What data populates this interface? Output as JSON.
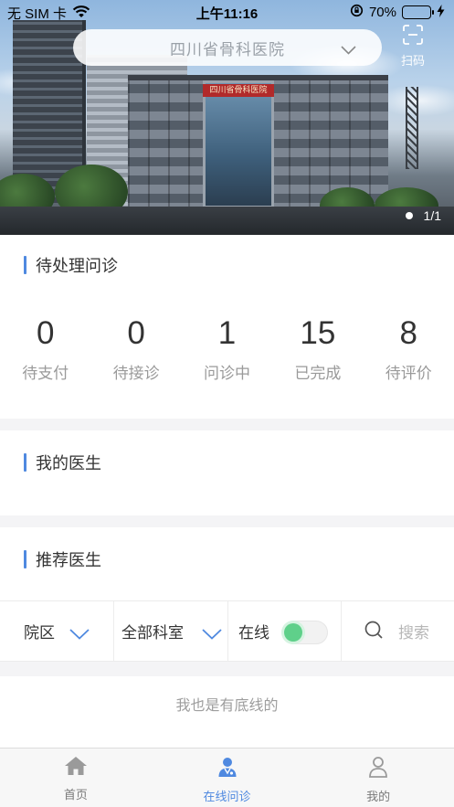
{
  "status_bar": {
    "carrier": "无 SIM 卡",
    "time": "上午11:16",
    "battery": "70%",
    "battery_level": 0.7
  },
  "header": {
    "hospital_name": "四川省骨科医院",
    "scan_label": "扫码",
    "banner_sign": "四川省骨科医院",
    "banner_pager": "1/1"
  },
  "pending": {
    "title": "待处理问诊",
    "stats": [
      {
        "value": "0",
        "label": "待支付"
      },
      {
        "value": "0",
        "label": "待接诊"
      },
      {
        "value": "1",
        "label": "问诊中"
      },
      {
        "value": "15",
        "label": "已完成"
      },
      {
        "value": "8",
        "label": "待评价"
      }
    ]
  },
  "my_doctor": {
    "title": "我的医生"
  },
  "recommend": {
    "title": "推荐医生"
  },
  "filter": {
    "district": "院区",
    "department": "全部科室",
    "online_label": "在线",
    "online_on": true,
    "search_placeholder": "搜索"
  },
  "bottom_note": "我也是有底线的",
  "tabbar": {
    "tabs": [
      {
        "label": "首页"
      },
      {
        "label": "在线问诊"
      },
      {
        "label": "我的"
      }
    ],
    "active": "在线问诊"
  },
  "colors": {
    "accent": "#4f89e0",
    "toggle_on": "#5fd08a",
    "muted_text": "#9a9a9a"
  }
}
